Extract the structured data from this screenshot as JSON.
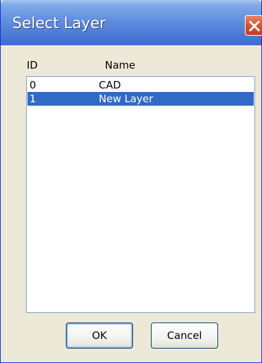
{
  "dialog": {
    "title": "Select Layer"
  },
  "list": {
    "columns": [
      "ID",
      "Name"
    ],
    "rows": [
      {
        "id": "0",
        "name": "CAD",
        "selected": false
      },
      {
        "id": "1",
        "name": "New Layer",
        "selected": true
      }
    ]
  },
  "buttons": {
    "ok_label": "OK",
    "cancel_label": "Cancel"
  },
  "colors": {
    "selection": "#316ac5",
    "titlebar": "#628ede",
    "close": "#d9532f"
  },
  "icons": {
    "close": "close-icon"
  }
}
